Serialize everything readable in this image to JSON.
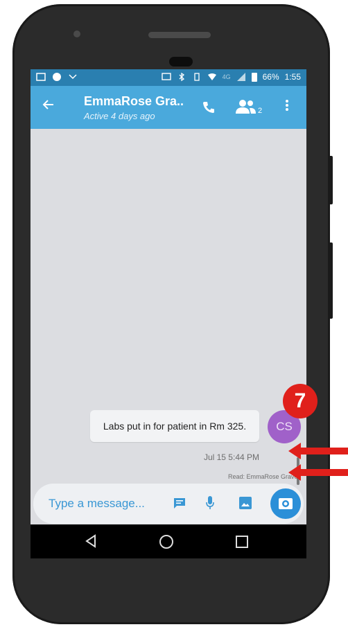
{
  "status_bar": {
    "battery": "66%",
    "time": "1:55",
    "network": "4G"
  },
  "header": {
    "back_icon": "arrow-left-icon",
    "title": "EmmaRose Gra..",
    "subtitle": "Active 4 days ago",
    "call_icon": "phone-icon",
    "participants_icon": "people-icon",
    "participants_count": "2",
    "more_icon": "more-vertical-icon"
  },
  "conversation": {
    "message_text": "Labs put in for patient in Rm 325.",
    "avatar_initials": "CS",
    "timestamp": "Jul 15 5:44 PM",
    "read_receipt": "Read: EmmaRose Graves"
  },
  "composer": {
    "placeholder": "Type a message...",
    "icons": [
      "chat-icon",
      "mic-icon",
      "image-icon",
      "camera-icon"
    ]
  },
  "annotation": {
    "step_number": "7",
    "color": "#e0201b"
  },
  "colors": {
    "app_bar": "#4aa9dc",
    "status_bar": "#2a7fb0",
    "accent": "#2b8fd8",
    "avatar": "#a061c9"
  }
}
